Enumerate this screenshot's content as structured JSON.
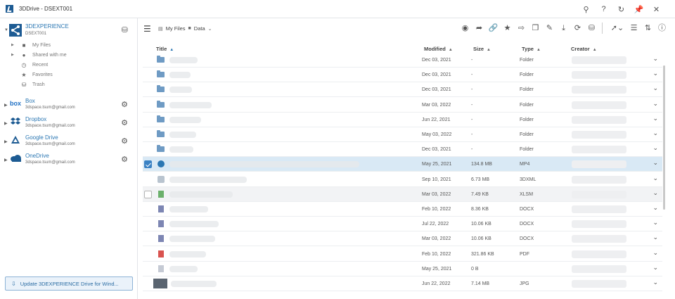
{
  "window": {
    "title": "3DDrive - DSEXT001"
  },
  "title_icons": [
    "search-icon",
    "help-icon",
    "refresh-icon",
    "pin-icon",
    "close-icon"
  ],
  "sidebar": {
    "primary": {
      "name": "3DEXPERIENCE",
      "subtitle": "DSEXT001"
    },
    "tree": [
      {
        "label": "My Files",
        "icon": "folder-icon",
        "caret": true
      },
      {
        "label": "Shared with me",
        "icon": "users-icon",
        "caret": true
      },
      {
        "label": "Recent",
        "icon": "clock-icon",
        "caret": false
      },
      {
        "label": "Favorites",
        "icon": "star-icon",
        "caret": false
      },
      {
        "label": "Trash",
        "icon": "trash-icon",
        "caret": false
      }
    ],
    "accounts": [
      {
        "name": "Box",
        "email": "3dspace.tsum@gmail.com",
        "logo": "box"
      },
      {
        "name": "Dropbox",
        "email": "3dspace.tsum@gmail.com",
        "logo": "dropbox"
      },
      {
        "name": "Google Drive",
        "email": "3dspace.tsum@gmail.com",
        "logo": "gdrive"
      },
      {
        "name": "OneDrive",
        "email": "3dspace.tsum@gmail.com",
        "logo": "onedrive"
      }
    ],
    "update_button": "Update 3DEXPERIENCE Drive for Wind..."
  },
  "breadcrumb": {
    "root": "My Files",
    "current": "Data"
  },
  "columns": {
    "title": "Title",
    "modified": "Modified",
    "size": "Size",
    "type": "Type",
    "creator": "Creator"
  },
  "rows": [
    {
      "icon": "folder",
      "modified": "Dec 03, 2021",
      "size": "-",
      "type": "Folder"
    },
    {
      "icon": "folder",
      "modified": "Dec 03, 2021",
      "size": "-",
      "type": "Folder"
    },
    {
      "icon": "folder",
      "modified": "Dec 03, 2021",
      "size": "-",
      "type": "Folder"
    },
    {
      "icon": "folder",
      "modified": "Mar 03, 2022",
      "size": "-",
      "type": "Folder"
    },
    {
      "icon": "folder",
      "modified": "Jun 22, 2021",
      "size": "-",
      "type": "Folder"
    },
    {
      "icon": "folder",
      "modified": "May 03, 2022",
      "size": "-",
      "type": "Folder"
    },
    {
      "icon": "folder",
      "modified": "Dec 03, 2021",
      "size": "-",
      "type": "Folder"
    },
    {
      "icon": "mp4",
      "modified": "May 25, 2021",
      "size": "134.8 MB",
      "type": "MP4",
      "selected": true
    },
    {
      "icon": "xml",
      "modified": "Sep 10, 2021",
      "size": "6.73 MB",
      "type": "3DXML"
    },
    {
      "icon": "green",
      "modified": "Mar 03, 2022",
      "size": "7.49 KB",
      "type": "XLSM",
      "hover": true
    },
    {
      "icon": "blue",
      "modified": "Feb 10, 2022",
      "size": "8.36 KB",
      "type": "DOCX"
    },
    {
      "icon": "blue",
      "modified": "Jul 22, 2022",
      "size": "10.06 KB",
      "type": "DOCX"
    },
    {
      "icon": "blue",
      "modified": "Mar 03, 2022",
      "size": "10.06 KB",
      "type": "DOCX"
    },
    {
      "icon": "red",
      "modified": "Feb 10, 2022",
      "size": "321.86 KB",
      "type": "PDF"
    },
    {
      "icon": "grey",
      "modified": "May 25, 2021",
      "size": "0 B",
      "type": ""
    },
    {
      "icon": "thumb",
      "modified": "Jun 22, 2022",
      "size": "7.14 MB",
      "type": "JPG"
    }
  ]
}
